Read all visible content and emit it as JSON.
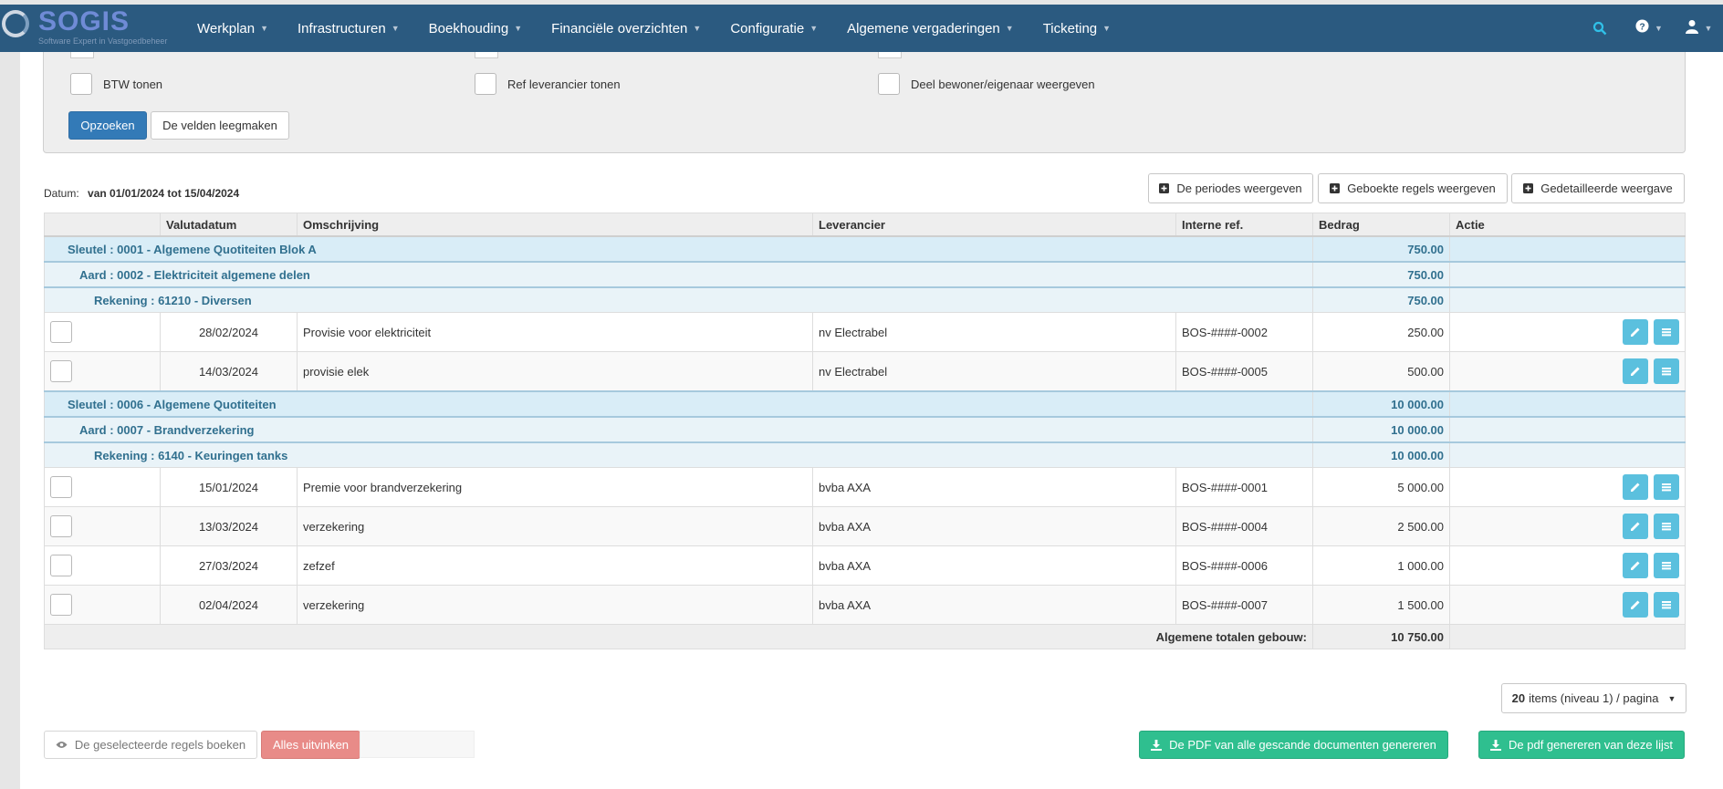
{
  "brand": {
    "logo_text": "SOGIS",
    "tagline": "Software Expert in Vastgoedbeheer"
  },
  "nav": {
    "items": [
      "Werkplan",
      "Infrastructuren",
      "Boekhouding",
      "Financiële overzichten",
      "Configuratie",
      "Algemene vergaderingen",
      "Ticketing"
    ],
    "icons": [
      "search-icon",
      "help-icon",
      "user-icon"
    ]
  },
  "filters": {
    "btw_label": "BTW tonen",
    "ref_label": "Ref leverancier tonen",
    "deel_label": "Deel bewoner/eigenaar weergeven",
    "search_button": "Opzoeken",
    "clear_button": "De velden leegmaken"
  },
  "period": {
    "label": "Datum:",
    "value": "van 01/01/2024 tot 15/04/2024"
  },
  "view_buttons": {
    "periods": "De periodes weergeven",
    "booked": "Geboekte regels weergeven",
    "detailed": "Gedetailleerde weergave"
  },
  "table": {
    "headers": {
      "date": "Valutadatum",
      "desc": "Omschrijving",
      "supplier": "Leverancier",
      "ref": "Interne ref.",
      "amount": "Bedrag",
      "action": "Actie"
    },
    "groups": [
      {
        "key_label": "Sleutel : 0001 - Algemene Quotiteiten Blok A",
        "key_total": "750.00",
        "aard_label": "Aard : 0002 - Elektriciteit algemene delen",
        "aard_total": "750.00",
        "rek_label": "Rekening : 61210 - Diversen",
        "rek_total": "750.00",
        "rows": [
          {
            "date": "28/02/2024",
            "desc": "Provisie voor elektriciteit",
            "supplier": "nv Electrabel",
            "ref": "BOS-####-0002",
            "amount": "250.00"
          },
          {
            "date": "14/03/2024",
            "desc": "provisie elek",
            "supplier": "nv Electrabel",
            "ref": "BOS-####-0005",
            "amount": "500.00"
          }
        ]
      },
      {
        "key_label": "Sleutel : 0006 - Algemene Quotiteiten",
        "key_total": "10 000.00",
        "aard_label": "Aard : 0007 - Brandverzekering",
        "aard_total": "10 000.00",
        "rek_label": "Rekening : 6140 - Keuringen tanks",
        "rek_total": "10 000.00",
        "rows": [
          {
            "date": "15/01/2024",
            "desc": "Premie voor brandverzekering",
            "supplier": "bvba AXA",
            "ref": "BOS-####-0001",
            "amount": "5 000.00"
          },
          {
            "date": "13/03/2024",
            "desc": "verzekering",
            "supplier": "bvba AXA",
            "ref": "BOS-####-0004",
            "amount": "2 500.00"
          },
          {
            "date": "27/03/2024",
            "desc": "zefzef",
            "supplier": "bvba AXA",
            "ref": "BOS-####-0006",
            "amount": "1 000.00"
          },
          {
            "date": "02/04/2024",
            "desc": "verzekering",
            "supplier": "bvba AXA",
            "ref": "BOS-####-0007",
            "amount": "1 500.00"
          }
        ]
      }
    ],
    "total_label": "Algemene totalen gebouw:",
    "total_value": "10 750.00"
  },
  "pagination": {
    "count": "20",
    "label": "items (niveau 1) / pagina"
  },
  "footer": {
    "book_selected": "De geselecteerde regels boeken",
    "uncheck_all": "Alles uitvinken",
    "pdf_scans": "De PDF van alle gescande documenten genereren",
    "pdf_list": "De pdf genereren van deze lijst"
  },
  "colors": {
    "navbar": "#2b5a80",
    "primary": "#337ab7",
    "info": "#5bc0de",
    "success": "#2fbf8f",
    "danger": "#e88b88",
    "group_bg": "#d9edf7",
    "group_text": "#31708f"
  }
}
